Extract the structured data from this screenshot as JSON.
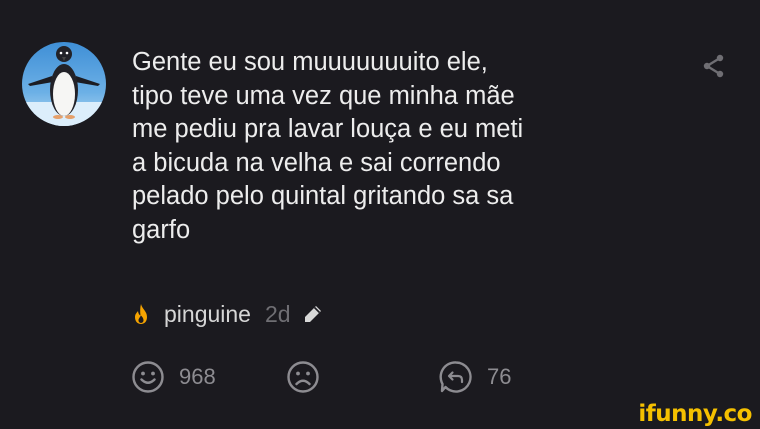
{
  "post": {
    "text": "Gente eu sou muuuuuuuito ele,\ntipo teve uma vez que minha mãe\nme pediu pra lavar louça e eu meti\na bicuda na velha e sai correndo\npelado pelo quintal gritando sa sa\ngarfo",
    "username": "pinguine",
    "time": "2d"
  },
  "actions": {
    "smile_count": "968",
    "reply_count": "76"
  },
  "icons": {
    "share": "share-icon",
    "flame": "flame-icon",
    "edit": "pencil-icon",
    "smile": "smile-icon",
    "frown": "frown-icon",
    "reply": "reply-icon"
  },
  "colors": {
    "background": "#1b1a1f",
    "text": "#ededed",
    "muted": "#6f6e73",
    "flame": "#f5a300",
    "watermark": "#f5c000"
  },
  "watermark": "ifunny.co"
}
